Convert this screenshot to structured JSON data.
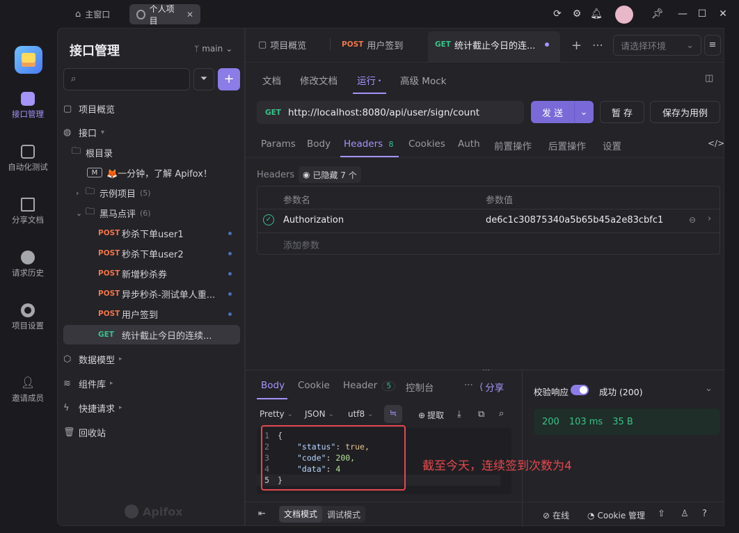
{
  "titlebar": {
    "home_tab": "主窗口",
    "project_tab": "个人项目"
  },
  "rail": {
    "items": [
      {
        "label": "接口管理",
        "active": true
      },
      {
        "label": "自动化测试"
      },
      {
        "label": "分享文档"
      },
      {
        "label": "请求历史"
      },
      {
        "label": "项目设置"
      },
      {
        "label": "邀请成员"
      }
    ]
  },
  "sidebar": {
    "title": "接口管理",
    "branch": "main",
    "overview": "项目概览",
    "api_group": "接口",
    "root": "根目录",
    "intro_doc": "🦊一分钟，了解 Apifox！",
    "folders": [
      {
        "name": "示例项目",
        "count": "(5)"
      },
      {
        "name": "黑马点评",
        "count": "(6)"
      }
    ],
    "endpoints": [
      {
        "method": "POST",
        "name": "秒杀下单user1"
      },
      {
        "method": "POST",
        "name": "秒杀下单user2"
      },
      {
        "method": "POST",
        "name": "新增秒杀券"
      },
      {
        "method": "POST",
        "name": "异步秒杀-测试单人重..."
      },
      {
        "method": "POST",
        "name": "用户签到"
      },
      {
        "method": "GET",
        "name": "统计截止今日的连续..."
      }
    ],
    "data_model": "数据模型",
    "component_lib": "组件库",
    "quick_request": "快捷请求",
    "recycle_bin": "回收站",
    "watermark": "Apifox"
  },
  "main": {
    "tabs": [
      {
        "label": "项目概览"
      },
      {
        "method": "POST",
        "label": "用户签到"
      },
      {
        "method": "GET",
        "label": "统计截止今日的连..."
      }
    ],
    "env_placeholder": "请选择环境",
    "subtabs": [
      "文档",
      "修改文档",
      "运行",
      "高级 Mock"
    ],
    "request": {
      "method": "GET",
      "url": "http://localhost:8080/api/user/sign/count",
      "send": "发 送",
      "save": "暂 存",
      "save_as": "保存为用例"
    },
    "param_tabs": [
      "Params",
      "Body",
      "Headers",
      "Cookies",
      "Auth",
      "前置操作",
      "后置操作",
      "设置"
    ],
    "headers_count": "8",
    "headers_label": "Headers",
    "hidden_label": "已隐藏 7 个",
    "table": {
      "col_name": "参数名",
      "col_value": "参数值",
      "row_name": "Authorization",
      "row_value": "de6c1c30875340a5b65b45a2e83cbfc1",
      "add_param": "添加参数"
    }
  },
  "response": {
    "tabs": [
      "Body",
      "Cookie",
      "Header",
      "控制台"
    ],
    "header_count": "5",
    "share": "分享",
    "format": "Pretty",
    "type": "JSON",
    "encoding": "utf8",
    "extract": "提取",
    "code_lines": [
      {
        "n": "1",
        "text": "{"
      },
      {
        "n": "2",
        "key": "\"status\"",
        "val": "true,"
      },
      {
        "n": "3",
        "key": "\"code\"",
        "val": "200,"
      },
      {
        "n": "4",
        "key": "\"data\"",
        "val": "4"
      },
      {
        "n": "5",
        "text": "}"
      }
    ],
    "annotation": "截至今天，连续签到次数为4",
    "validate_label": "校验响应",
    "status_text": "成功 (200)",
    "status_code": "200",
    "time": "103 ms",
    "size": "35 B"
  },
  "footer": {
    "doc_mode": "文档模式",
    "debug_mode": "调试模式",
    "online": "在线",
    "cookie_mgmt": "Cookie 管理"
  },
  "colors": {
    "accent": "#a594f9",
    "post": "#f2754b",
    "get": "#36c48a",
    "annotation": "#e5484d"
  }
}
